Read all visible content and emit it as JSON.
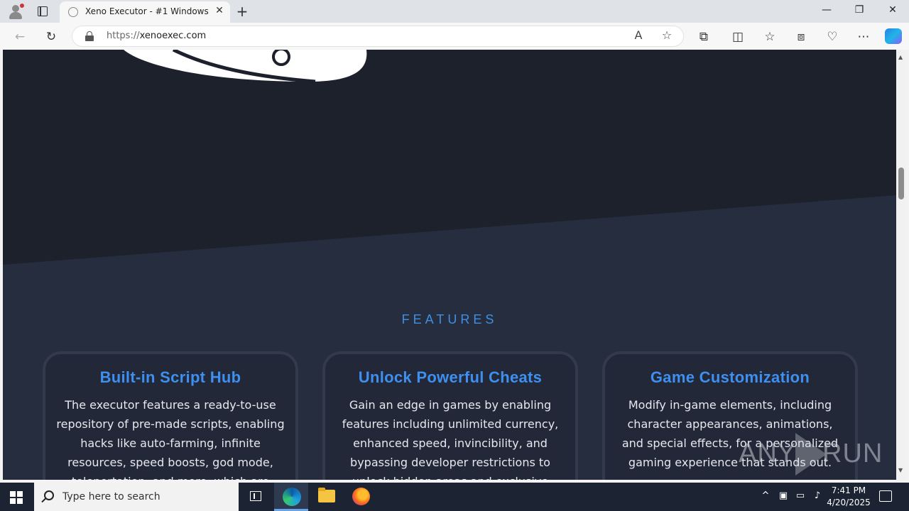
{
  "browser": {
    "tab_title": "Xeno Executor - #1 Windows Scri",
    "url_protocol": "https://",
    "url_host": "xenoexec.com",
    "tab_close_glyph": "✕",
    "new_tab_glyph": "+",
    "minimize_glyph": "—",
    "maximize_glyph": "❐",
    "close_glyph": "✕"
  },
  "page": {
    "section_label": "FEATURES",
    "features": [
      {
        "title": "Built-in Script Hub",
        "description": "The executor features a ready-to-use repository of pre-made scripts, enabling hacks like auto-farming, infinite resources, speed boosts, god mode, teleportation, and more, which are available for quick"
      },
      {
        "title": "Unlock Powerful Cheats",
        "description": "Gain an edge in games by enabling features including unlimited currency, enhanced speed, invincibility, and bypassing developer restrictions to unlock hidden areas and exclusive items."
      },
      {
        "title": "Game Customization",
        "description": "Modify in-game elements, including character appearances, animations, and special effects, for a personalized gaming experience that stands out."
      }
    ]
  },
  "watermark": {
    "left": "ANY",
    "right": "RUN"
  },
  "taskbar": {
    "search_placeholder": "Type here to search",
    "time": "7:41 PM",
    "date": "4/20/2025"
  },
  "colors": {
    "accent": "#3d8ff0",
    "page_bg": "#262d3e",
    "hero_bg": "#1d212c",
    "card_border": "#333a4c"
  },
  "icons": [
    "profile-icon",
    "tab-actions-icon",
    "back-icon",
    "refresh-icon",
    "lock-icon",
    "read-aloud-icon",
    "favorite-star-icon",
    "extensions-icon",
    "split-screen-icon",
    "favorites-icon",
    "collections-icon",
    "browser-essentials-icon",
    "more-icon",
    "copilot-icon",
    "windows-start-icon",
    "search-icon",
    "task-view-icon",
    "edge-icon",
    "file-explorer-icon",
    "firefox-icon"
  ]
}
